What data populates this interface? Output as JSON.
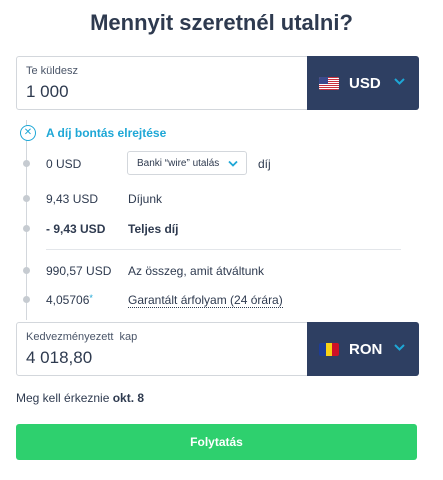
{
  "title": "Mennyit szeretnél utalni?",
  "send": {
    "label": "Te küldesz",
    "amount": "1 000",
    "currency": "USD",
    "flag_icon": "us-flag-icon"
  },
  "breakdown": {
    "toggle_label": "A díj bontás elrejtése",
    "rows": [
      {
        "amount": "0 USD",
        "select_value": "Banki “wire” utalás",
        "suffix": "díj"
      },
      {
        "amount": "9,43 USD",
        "label": "Díjunk"
      },
      {
        "amount": "- 9,43 USD",
        "label": "Teljes díj"
      },
      {
        "amount": "990,57 USD",
        "label": "Az összeg, amit átváltunk"
      },
      {
        "amount": "4,05706",
        "star": "*",
        "label": "Garantált árfolyam (24 órára)"
      }
    ]
  },
  "receive": {
    "label": "Kedvezményezett  kap",
    "amount": "4 018,80",
    "currency": "RON",
    "flag_icon": "ro-flag-icon"
  },
  "arrival": {
    "prefix": "Meg kell érkeznie",
    "date": "okt. 8"
  },
  "continue_label": "Folytatás",
  "colors": {
    "accent": "#1ea7d6",
    "currency_bg": "#2e3f62",
    "primary_button": "#2ed06e",
    "text": "#2e3a4f"
  }
}
